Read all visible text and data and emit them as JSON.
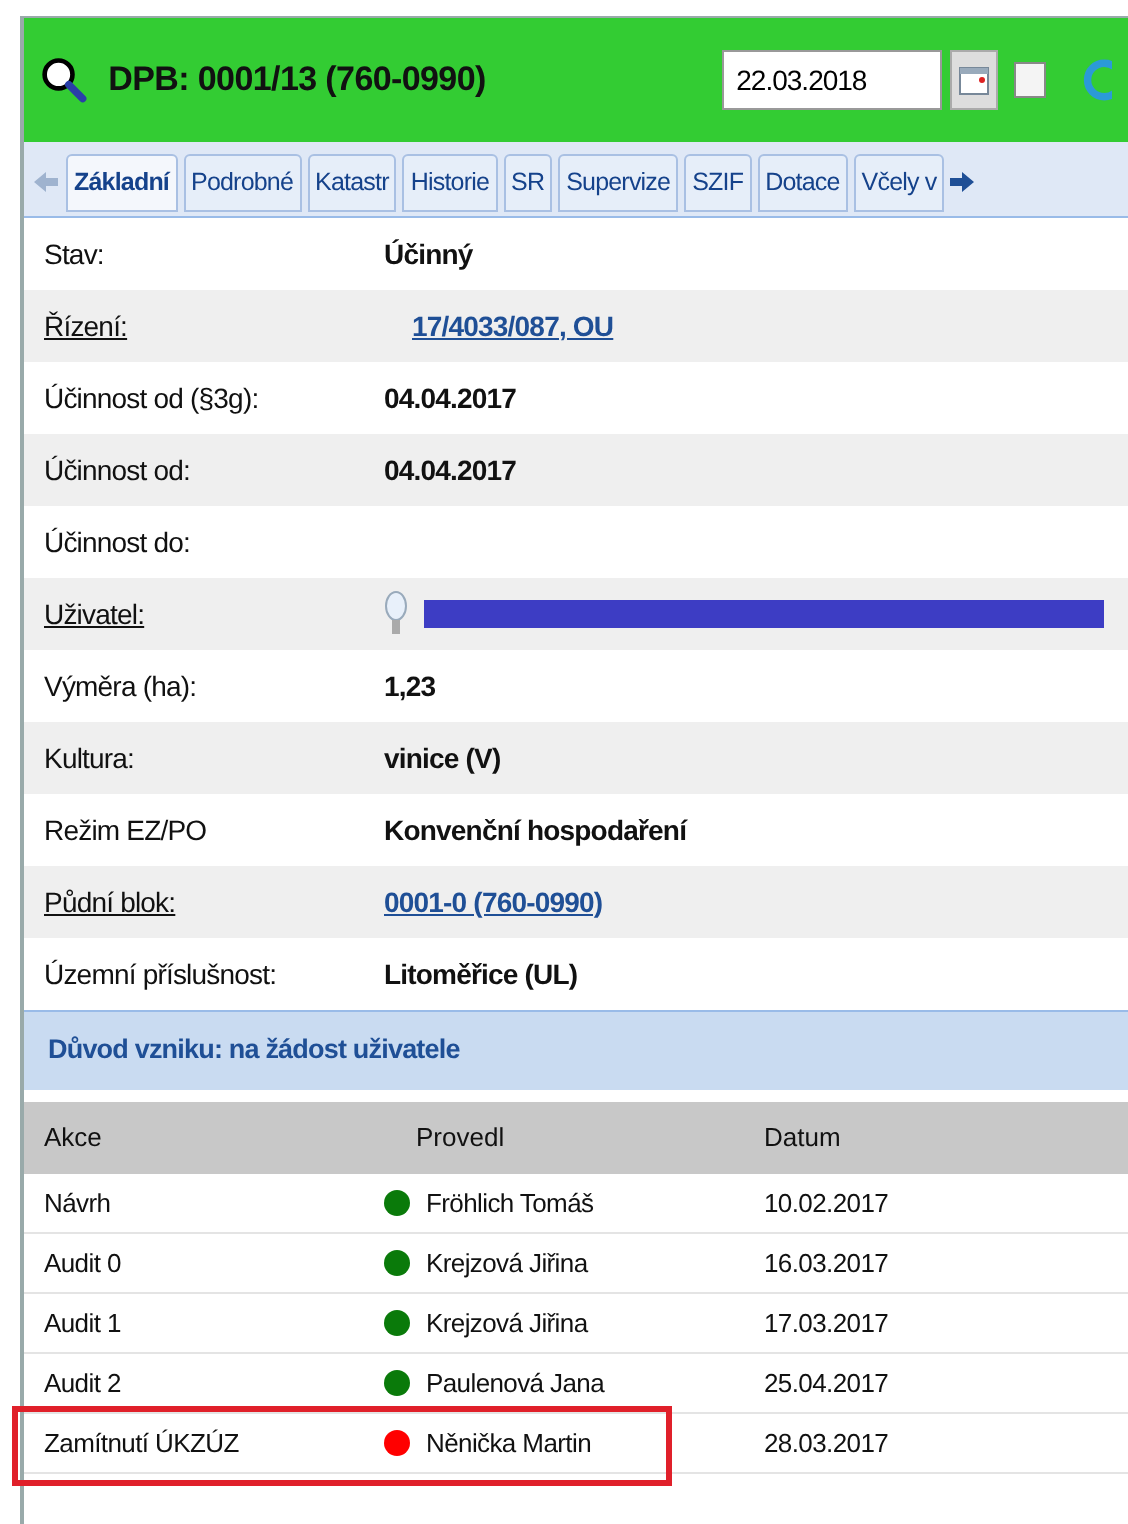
{
  "header": {
    "title": "DPB: 0001/13 (760-0990)",
    "date": "22.03.2018",
    "checked": false
  },
  "tabs": [
    {
      "label": "Základní",
      "selected": true
    },
    {
      "label": "Podrobné",
      "selected": false
    },
    {
      "label": "Katastr",
      "selected": false
    },
    {
      "label": "Historie",
      "selected": false
    },
    {
      "label": "SR",
      "selected": false
    },
    {
      "label": "Supervize",
      "selected": false
    },
    {
      "label": "SZIF",
      "selected": false
    },
    {
      "label": "Dotace",
      "selected": false
    },
    {
      "label": "Včely v",
      "selected": false
    }
  ],
  "fields": [
    {
      "label": "Stav:",
      "label_link": false,
      "kind": "bold",
      "value": "Účinný"
    },
    {
      "label": "Řízení:",
      "label_link": true,
      "kind": "link",
      "value": "17/4033/087, OU"
    },
    {
      "label": "Účinnost od (§3g):",
      "label_link": false,
      "kind": "bold",
      "value": "04.04.2017"
    },
    {
      "label": "Účinnost od:",
      "label_link": false,
      "kind": "bold",
      "value": "04.04.2017"
    },
    {
      "label": "Účinnost do:",
      "label_link": false,
      "kind": "empty"
    },
    {
      "label": "Uživatel:",
      "label_link": true,
      "kind": "redacted"
    },
    {
      "label": "Výměra (ha):",
      "label_link": false,
      "kind": "bold",
      "value": "1,23"
    },
    {
      "label": "Kultura:",
      "label_link": false,
      "kind": "bold",
      "value": "vinice (V)"
    },
    {
      "label": "Režim EZ/PO",
      "label_link": false,
      "kind": "bold",
      "value": "Konvenční hospodaření"
    },
    {
      "label": "Půdní blok:",
      "label_link": true,
      "kind": "link",
      "value": "0001-0 (760-0990)"
    },
    {
      "label": "Územní příslušnost:",
      "label_link": false,
      "kind": "bold",
      "value": "Litoměřice (UL)"
    }
  ],
  "reason": "Důvod vzniku: na žádost uživatele",
  "history": {
    "columns": [
      "Akce",
      "Provedl",
      "Datum"
    ],
    "rows": [
      {
        "action": "Návrh",
        "color": "#0a7a0a",
        "person": "Fröhlich Tomáš",
        "date": "10.02.2017",
        "highlighted": false
      },
      {
        "action": "Audit 0",
        "color": "#0a7a0a",
        "person": "Krejzová Jiřina",
        "date": "16.03.2017",
        "highlighted": false
      },
      {
        "action": "Audit 1",
        "color": "#0a7a0a",
        "person": "Krejzová Jiřina",
        "date": "17.03.2017",
        "highlighted": false
      },
      {
        "action": "Audit 2",
        "color": "#0a7a0a",
        "person": "Paulenová Jana",
        "date": "25.04.2017",
        "highlighted": false
      },
      {
        "action": "Zamítnutí ÚKZÚZ",
        "color": "#ff0000",
        "person": "Něnička Martin",
        "date": "28.03.2017",
        "highlighted": true
      }
    ]
  }
}
